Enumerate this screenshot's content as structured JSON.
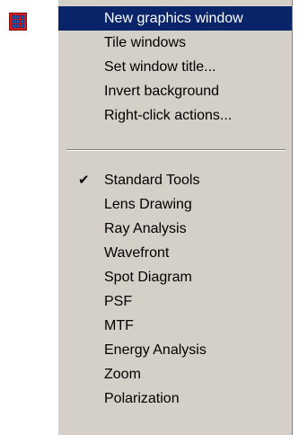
{
  "menu": {
    "top_items": [
      {
        "label": "New graphics window",
        "highlighted": true
      },
      {
        "label": "Tile windows"
      },
      {
        "label": "Set window title..."
      },
      {
        "label": "Invert background"
      },
      {
        "label": "Right-click actions..."
      }
    ],
    "tool_items": [
      {
        "label": "Standard Tools",
        "checked": true
      },
      {
        "label": "Lens Drawing"
      },
      {
        "label": "Ray Analysis"
      },
      {
        "label": "Wavefront"
      },
      {
        "label": "Spot Diagram"
      },
      {
        "label": "PSF"
      },
      {
        "label": "MTF"
      },
      {
        "label": "Energy Analysis"
      },
      {
        "label": "Zoom"
      },
      {
        "label": "Polarization"
      }
    ],
    "check_glyph": "✔"
  },
  "icons": {
    "app_icon": "grid-window-icon"
  },
  "colors": {
    "menu_background": "#d4d0c8",
    "highlight": "#0a246a",
    "highlight_text": "#ffffff",
    "icon_red": "#d31d1d",
    "icon_blue": "#1f62c9"
  }
}
